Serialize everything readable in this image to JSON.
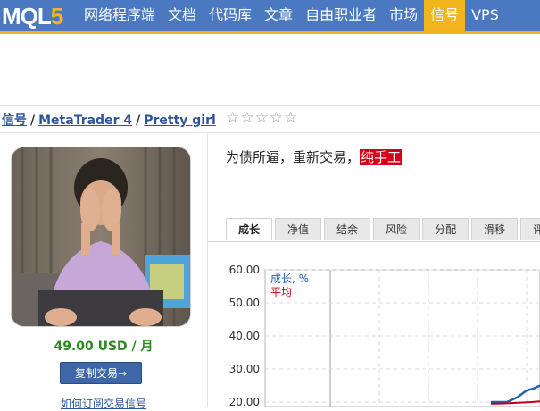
{
  "header": {
    "logo_main": "MQL",
    "logo_five": "5",
    "nav": [
      {
        "label": "网络程序端",
        "active": false
      },
      {
        "label": "文档",
        "active": false
      },
      {
        "label": "代码库",
        "active": false
      },
      {
        "label": "文章",
        "active": false
      },
      {
        "label": "自由职业者",
        "active": false
      },
      {
        "label": "市场",
        "active": false
      },
      {
        "label": "信号",
        "active": true
      },
      {
        "label": "VPS",
        "active": false
      }
    ]
  },
  "breadcrumb": {
    "items": [
      "信号",
      "MetaTrader 4",
      "Pretty girl"
    ],
    "separator": "/",
    "rating_stars": 5,
    "rating_filled": 0
  },
  "signal": {
    "price": "49.00 USD / 月",
    "copy_button": "复制交易→",
    "howto_link": "如何订阅交易信号",
    "description_prefix": "为债所逼，重新交易，",
    "description_highlight": "纯手工"
  },
  "tabs": [
    "成长",
    "净值",
    "结余",
    "风险",
    "分配",
    "滑移",
    "评"
  ],
  "active_tab": 0,
  "chart_data": {
    "type": "line",
    "y_ticks": [
      "60.00",
      "50.00",
      "40.00",
      "30.00",
      "20.00"
    ],
    "legend": [
      {
        "name": "成长, %",
        "color": "#1f5fb5"
      },
      {
        "name": "平均",
        "color": "#c0001a"
      }
    ],
    "grid": true,
    "series": [
      {
        "name": "成长, %",
        "color": "#1f5fb5",
        "visible_tail": [
          20.0,
          20.0,
          21.5,
          23.5,
          24.0,
          25.0
        ]
      },
      {
        "name": "平均",
        "color": "#c0001a",
        "visible_tail": [
          19.5,
          19.6,
          19.8,
          20.0,
          20.2
        ]
      }
    ]
  },
  "colors": {
    "nav_bg": "#4a79c2",
    "nav_accent": "#f3b51e",
    "link": "#2d5599",
    "price": "#2b8a1e",
    "highlight": "#d4001a"
  }
}
